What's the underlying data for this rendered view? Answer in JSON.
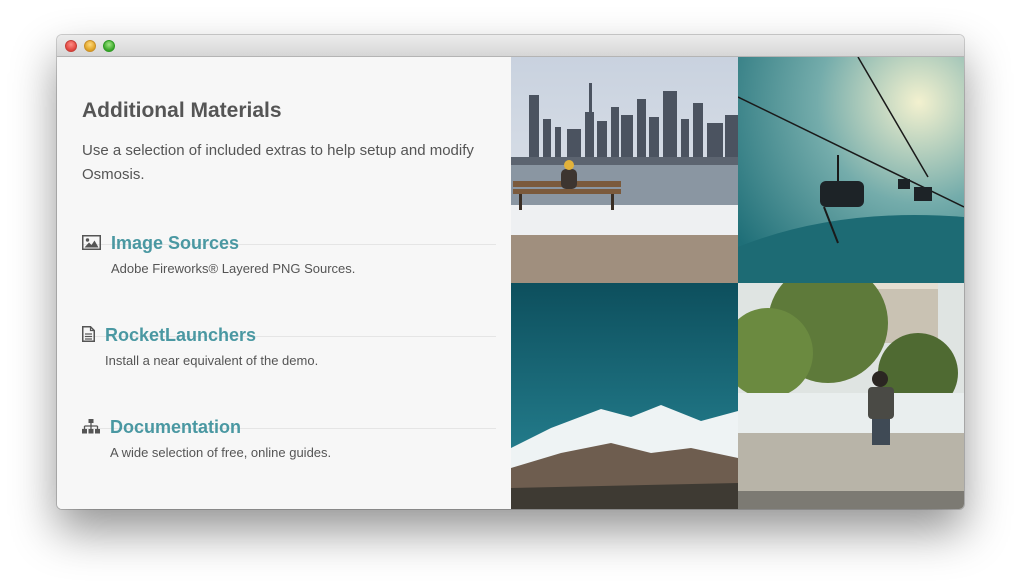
{
  "window": {
    "controls": [
      "close",
      "minimize",
      "zoom"
    ]
  },
  "main": {
    "title": "Additional Materials",
    "intro": "Use a selection of included extras to help setup and modify Osmosis."
  },
  "items": [
    {
      "icon": "image-icon",
      "title": "Image Sources",
      "description": "Adobe Fireworks® Layered PNG Sources."
    },
    {
      "icon": "document-icon",
      "title": "RocketLaunchers",
      "description": "Install a near equivalent of the demo."
    },
    {
      "icon": "sitemap-icon",
      "title": "Documentation",
      "description": "A wide selection of free, online guides."
    }
  ],
  "photos": [
    {
      "subject": "city-skyline-bench-photo"
    },
    {
      "subject": "ski-lift-photo"
    },
    {
      "subject": "snowy-mountain-photo"
    },
    {
      "subject": "person-on-wall-photo"
    }
  ],
  "colors": {
    "link": "#4a98a2",
    "text": "#555555",
    "panel_background": "#f7f7f7"
  }
}
